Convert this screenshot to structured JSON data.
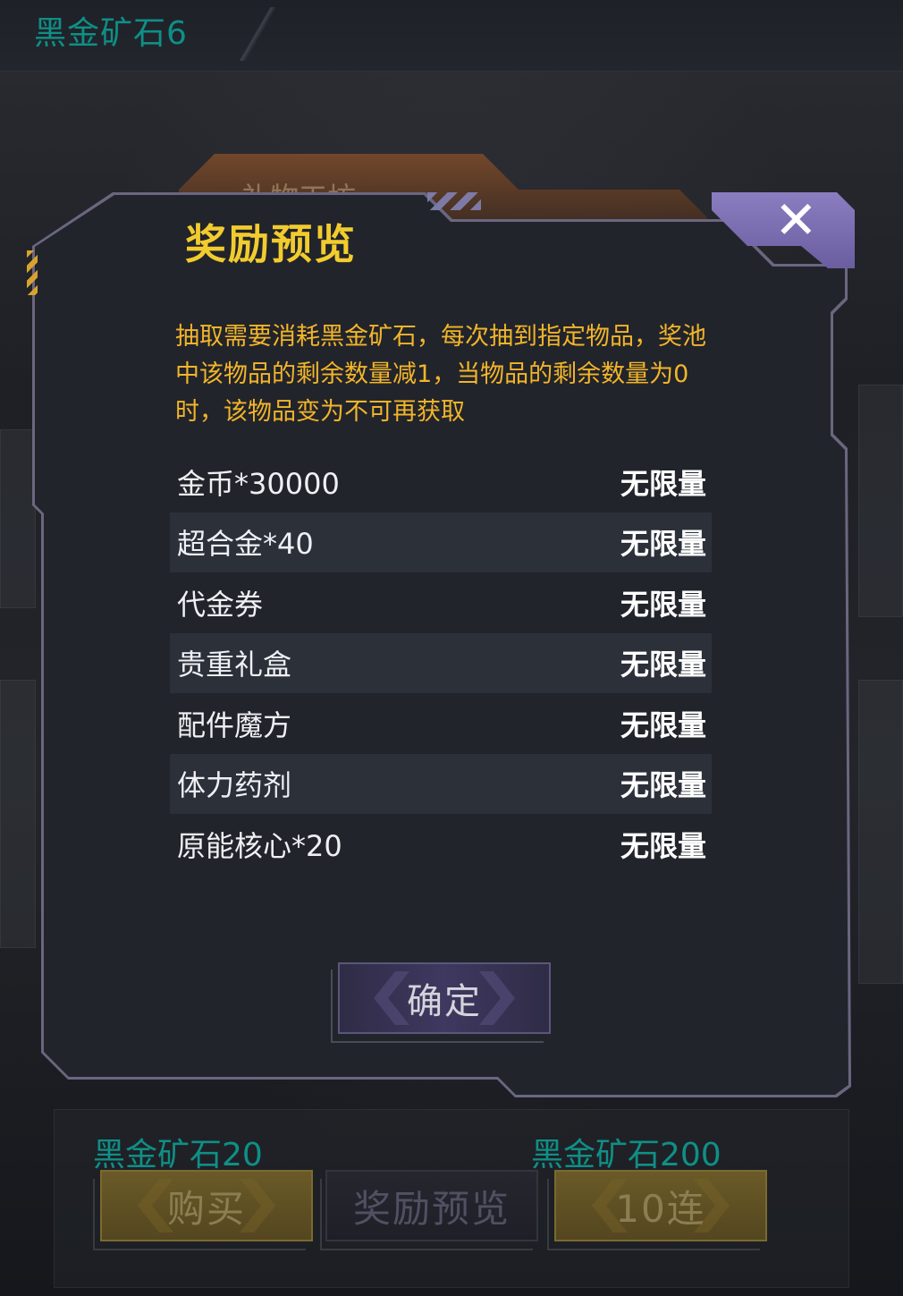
{
  "header": {
    "title": "黑金矿石6"
  },
  "behind_tab": {
    "label": "礼物工坊"
  },
  "dialog": {
    "title": "奖励预览",
    "description": "抽取需要消耗黑金矿石，每次抽到指定物品，奖池中该物品的剩余数量减1，当物品的剩余数量为0时，该物品变为不可再获取",
    "rewards": [
      {
        "name": "金币*30000",
        "qty": "无限量"
      },
      {
        "name": "超合金*40",
        "qty": "无限量"
      },
      {
        "name": "代金券",
        "qty": "无限量"
      },
      {
        "name": "贵重礼盒",
        "qty": "无限量"
      },
      {
        "name": "配件魔方",
        "qty": "无限量"
      },
      {
        "name": "体力药剂",
        "qty": "无限量"
      },
      {
        "name": "原能核心*20",
        "qty": "无限量"
      }
    ],
    "confirm_label": "确定",
    "close_icon": "close-icon"
  },
  "bottom": {
    "cost_left": "黑金矿石20",
    "cost_right": "黑金矿石200",
    "buy_label": "购买",
    "preview_label": "奖励预览",
    "ten_label": "10连"
  },
  "colors": {
    "title_gold": "#f2cc2e",
    "desc_orange": "#f2b52a",
    "teal_cost": "#0f8f86",
    "dialog_bg": "#22242b",
    "row_alt": "#2b3039",
    "close_purple": "#7a6eb0"
  }
}
